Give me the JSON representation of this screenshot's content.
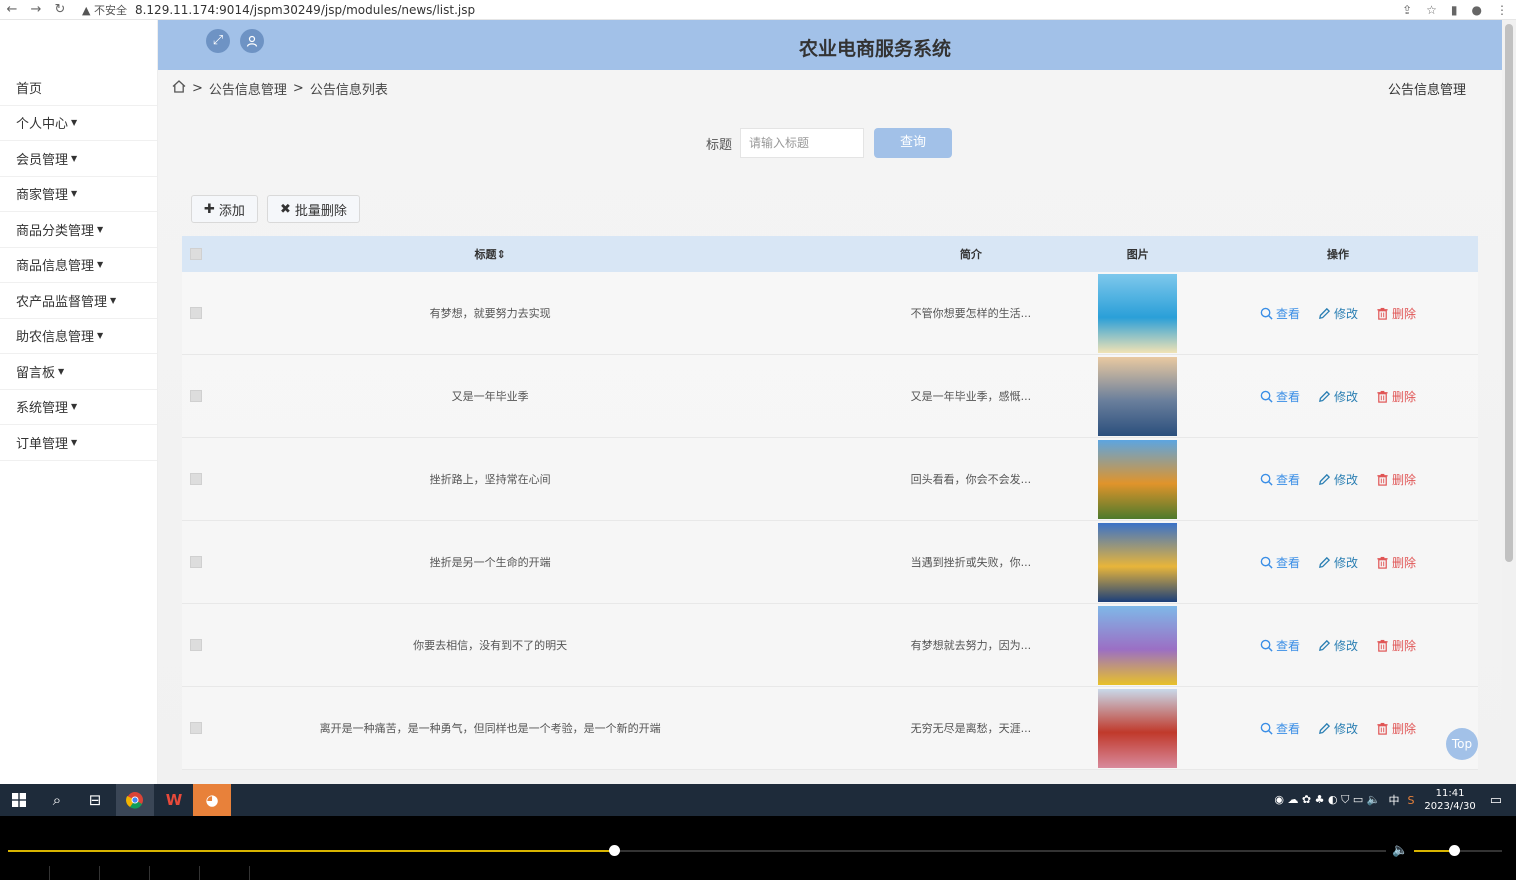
{
  "browser": {
    "security": "不安全",
    "url": "8.129.11.174:9014/jspm30249/jsp/modules/news/list.jsp"
  },
  "app": {
    "title": "农业电商服务系统"
  },
  "sidebar": {
    "items": [
      {
        "label": "首页",
        "caret": false
      },
      {
        "label": "个人中心",
        "caret": true
      },
      {
        "label": "会员管理",
        "caret": true
      },
      {
        "label": "商家管理",
        "caret": true
      },
      {
        "label": "商品分类管理",
        "caret": true
      },
      {
        "label": "商品信息管理",
        "caret": true
      },
      {
        "label": "农产品监督管理",
        "caret": true
      },
      {
        "label": "助农信息管理",
        "caret": true
      },
      {
        "label": "留言板",
        "caret": true
      },
      {
        "label": "系统管理",
        "caret": true
      },
      {
        "label": "订单管理",
        "caret": true
      }
    ]
  },
  "breadcrumb": {
    "level1": "公告信息管理",
    "level2": "公告信息列表",
    "right": "公告信息管理"
  },
  "search": {
    "label": "标题",
    "placeholder": "请输入标题",
    "button": "查询"
  },
  "toolbar": {
    "add": "添加",
    "batch_delete": "批量删除"
  },
  "table": {
    "headers": {
      "title": "标题",
      "intro": "简介",
      "image": "图片",
      "ops": "操作"
    },
    "actions": {
      "view": "查看",
      "edit": "修改",
      "delete": "删除"
    },
    "rows": [
      {
        "title": "有梦想，就要努力去实现",
        "intro": "不管你想要怎样的生活...",
        "image_colors": [
          "#7ec8ec",
          "#2a9fd8",
          "#f1e3b5"
        ]
      },
      {
        "title": "又是一年毕业季",
        "intro": "又是一年毕业季，感慨...",
        "image_colors": [
          "#e9c9a0",
          "#6a7f9c",
          "#2b4f7d"
        ]
      },
      {
        "title": "挫折路上，坚持常在心间",
        "intro": "回头看看，你会不会发...",
        "image_colors": [
          "#5da5e0",
          "#e0942b",
          "#4e7a2c"
        ]
      },
      {
        "title": "挫折是另一个生命的开端",
        "intro": "当遇到挫折或失败，你...",
        "image_colors": [
          "#3b72c7",
          "#e8b53a",
          "#1c3f7a"
        ]
      },
      {
        "title": "你要去相信，没有到不了的明天",
        "intro": "有梦想就去努力，因为...",
        "image_colors": [
          "#7fb8e8",
          "#9b6fc4",
          "#e8c12a"
        ]
      },
      {
        "title": "离开是一种痛苦，是一种勇气，但同样也是一个考验，是一个新的开端",
        "intro": "无穷无尽是离愁，天涯...",
        "image_colors": [
          "#c9d9ea",
          "#c0392b",
          "#d88a9c"
        ]
      }
    ]
  },
  "back_to_top": "Top",
  "taskbar": {
    "time": "11:41",
    "date": "2023/4/30",
    "ime": "中"
  },
  "player": {
    "progress": 0.44,
    "volume": 0.45
  }
}
